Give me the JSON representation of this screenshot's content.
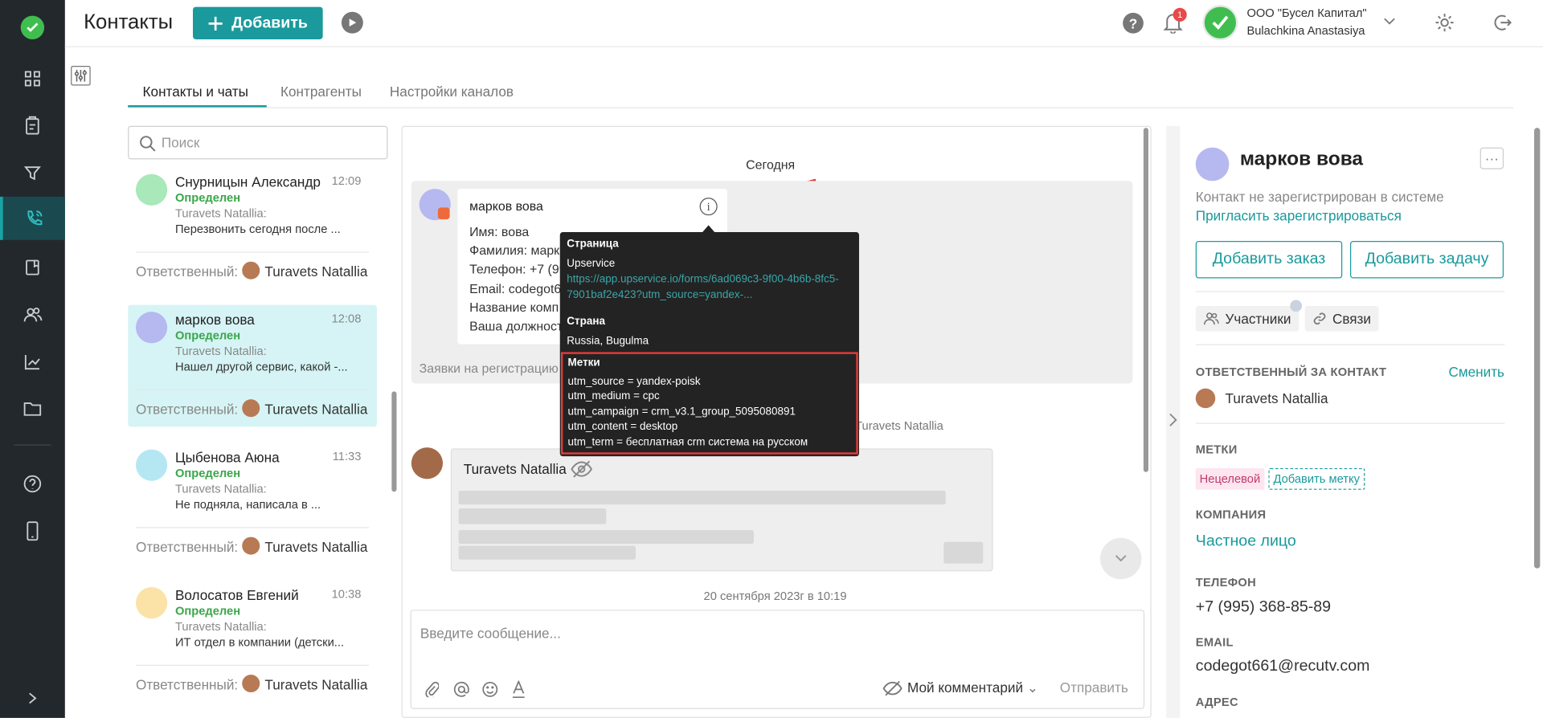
{
  "app": {
    "title": "Контакты",
    "add_label": "Добавить",
    "notification_count": "1",
    "company_name": "ООО \"Бусел Капитал\"",
    "user_name": "Bulachkina Anastasiya"
  },
  "tabs": [
    "Контакты и чаты",
    "Контрагенты",
    "Настройки каналов"
  ],
  "search": {
    "placeholder": "Поиск"
  },
  "contacts": [
    {
      "name": "Снурницын Александр",
      "time": "12:09",
      "status": "Определен",
      "owner": "Turavets Natallia:",
      "last": "Перезвонить сегодня после ...",
      "resp_label": "Ответственный:",
      "resp": "Turavets Natallia"
    },
    {
      "name": "марков вова",
      "time": "12:08",
      "status": "Определен",
      "owner": "Turavets Natallia:",
      "last": "Нашел другой сервис, какой -...",
      "resp_label": "Ответственный:",
      "resp": "Turavets Natallia"
    },
    {
      "name": "Цыбенова Аюна",
      "time": "11:33",
      "status": "Определен",
      "owner": "Turavets Natallia:",
      "last": "Не подняла, написала в ...",
      "resp_label": "Ответственный:",
      "resp": "Turavets Natallia"
    },
    {
      "name": "Волосатов Евгений",
      "time": "10:38",
      "status": "Определен",
      "owner": "Turavets Natallia:",
      "last": "ИТ отдел в компании (детски...",
      "resp_label": "Ответственный:",
      "resp": "Turavets Natallia"
    }
  ],
  "chat": {
    "date_label": "Сегодня",
    "card_title": "марков вова",
    "card_lines": [
      "Имя: вова",
      "Фамилия: марк",
      "Телефон: +7 (99",
      "Email: codegot6",
      "Название комп",
      "Ваша должност"
    ],
    "footer": "Заявки на регистрацию",
    "system_text": "Turavets Natallia",
    "message_author": "Turavets Natallia",
    "date2": "20 сентября 2023г в 10:19",
    "input_placeholder": "Введите сообщение...",
    "comment_label": "Мой комментарий",
    "send_label": "Отправить"
  },
  "tooltip": {
    "page_title": "Страница",
    "page_name": "Upservice",
    "page_url": "https://app.upservice.io/forms/6ad069c3-9f00-4b6b-8fc5-7901baf2e423?utm_source=yandex-...",
    "country_title": "Страна",
    "country": "Russia, Bugulma",
    "tags_title": "Метки",
    "tags": [
      "utm_source = yandex-poisk",
      "utm_medium = cpc",
      "utm_campaign = crm_v3.1_group_5095080891",
      "utm_content = desktop",
      "utm_term = бесплатная crm система на русском"
    ]
  },
  "panel": {
    "name": "марков вова",
    "not_registered": "Контакт не зарегистрирован в системе",
    "invite": "Пригласить зарегистрироваться",
    "add_order": "Добавить заказ",
    "add_task": "Добавить задачу",
    "participants": "Участники",
    "links": "Связи",
    "resp_title": "ОТВЕТСТВЕННЫЙ ЗА КОНТАКТ",
    "change": "Сменить",
    "resp_name": "Turavets Natallia",
    "tags_title": "МЕТКИ",
    "tag": "Нецелевой",
    "add_tag": "Добавить метку",
    "company_title": "КОМПАНИЯ",
    "company": "Частное лицо",
    "phone_title": "ТЕЛЕФОН",
    "phone": "+7 (995) 368-85-89",
    "email_title": "EMAIL",
    "email": "codegot661@recutv.com",
    "address_title": "АДРЕС"
  },
  "colors": {
    "accent": "#1a9a9c",
    "sidebar": "#23282d",
    "status_green": "#3aa64a",
    "alert": "#e23a3a"
  }
}
